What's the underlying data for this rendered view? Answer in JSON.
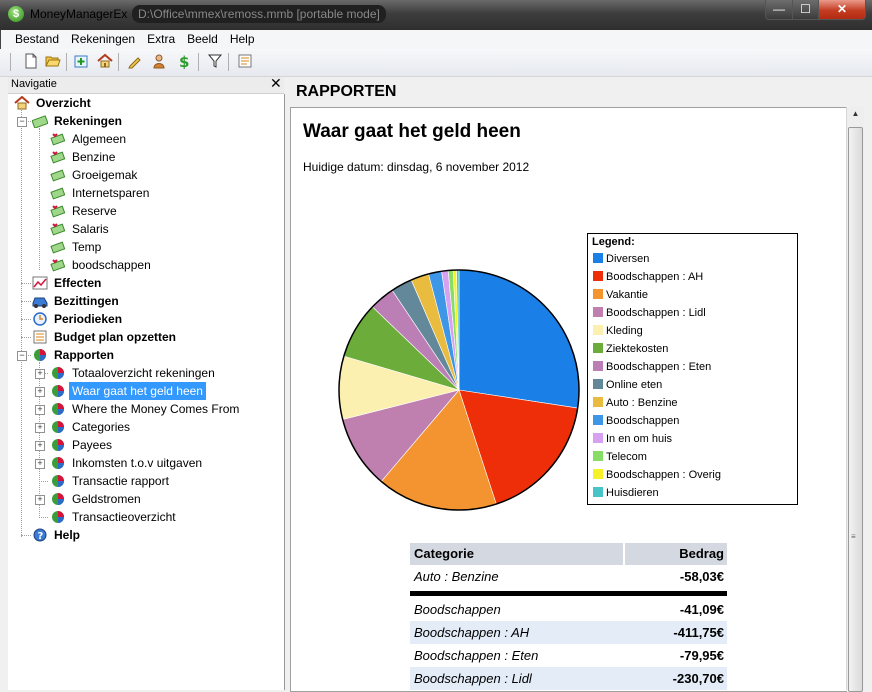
{
  "window": {
    "app_name": "MoneyManagerEx",
    "path": "D:\\Office\\mmex\\remoss.mmb [portable mode]",
    "min_glyph": "—",
    "max_glyph": "☐",
    "close_glyph": "✕"
  },
  "menu": [
    "Bestand",
    "Rekeningen",
    "Extra",
    "Beeld",
    "Help"
  ],
  "toolbar": {
    "icons": [
      "new-file-icon",
      "open-folder-icon",
      "new-account-icon",
      "home-icon",
      "edit-icon",
      "users-icon",
      "currency-icon",
      "filter-icon",
      "report-icon"
    ]
  },
  "navigation": {
    "title": "Navigatie",
    "close_glyph": "✕",
    "items": [
      {
        "label": "Overzicht"
      },
      {
        "label": "Rekeningen"
      },
      {
        "label": "Algemeen"
      },
      {
        "label": "Benzine"
      },
      {
        "label": "Groeigemak"
      },
      {
        "label": "Internetsparen"
      },
      {
        "label": "Reserve"
      },
      {
        "label": "Salaris"
      },
      {
        "label": "Temp"
      },
      {
        "label": "boodschappen"
      },
      {
        "label": "Effecten"
      },
      {
        "label": "Bezittingen"
      },
      {
        "label": "Periodieken"
      },
      {
        "label": "Budget plan opzetten"
      },
      {
        "label": "Rapporten"
      },
      {
        "label": "Totaaloverzicht rekeningen"
      },
      {
        "label": "Waar gaat het geld heen"
      },
      {
        "label": "Where the Money Comes From"
      },
      {
        "label": "Categories"
      },
      {
        "label": "Payees"
      },
      {
        "label": "Inkomsten t.o.v uitgaven"
      },
      {
        "label": "Transactie rapport"
      },
      {
        "label": "Geldstromen"
      },
      {
        "label": "Transactieoverzicht"
      },
      {
        "label": "Help"
      }
    ]
  },
  "panel": {
    "title": "RAPPORTEN"
  },
  "report": {
    "title": "Waar gaat het geld heen",
    "date": "Huidige datum: dinsdag, 6 november 2012",
    "legend_title": "Legend:",
    "table": {
      "headers": [
        "Categorie",
        "Bedrag"
      ],
      "rows": [
        {
          "category": "Auto : Benzine",
          "amount": "-58,03€"
        },
        {
          "category": "Boodschappen",
          "amount": "-41,09€"
        },
        {
          "category": "Boodschappen : AH",
          "amount": "-411,75€"
        },
        {
          "category": "Boodschappen : Eten",
          "amount": "-79,95€"
        },
        {
          "category": "Boodschappen : Lidl",
          "amount": "-230,70€"
        }
      ]
    }
  },
  "chart_data": {
    "type": "pie",
    "legend_position": "right",
    "categories": [
      "Diversen",
      "Boodschappen : AH",
      "Vakantie",
      "Boodschappen : Lidl",
      "Kleding",
      "Ziektekosten",
      "Boodschappen : Eten",
      "Online eten",
      "Auto : Benzine",
      "Boodschappen",
      "In en om huis",
      "Telecom",
      "Boodschappen : Overig",
      "Huisdieren"
    ],
    "colors": [
      "#1a7fe6",
      "#ee2e08",
      "#f49430",
      "#bf80b0",
      "#fcf0b0",
      "#6cac3a",
      "#bb7fb5",
      "#63889a",
      "#e9bb3e",
      "#3d96e6",
      "#d8a0f0",
      "#88dd66",
      "#f6f229",
      "#47c4c7"
    ],
    "values": [
      24.8,
      15.9,
      14.7,
      8.9,
      7.7,
      6.9,
      3.1,
      2.6,
      2.2,
      1.6,
      0.8,
      0.6,
      0.4,
      0.3
    ]
  }
}
